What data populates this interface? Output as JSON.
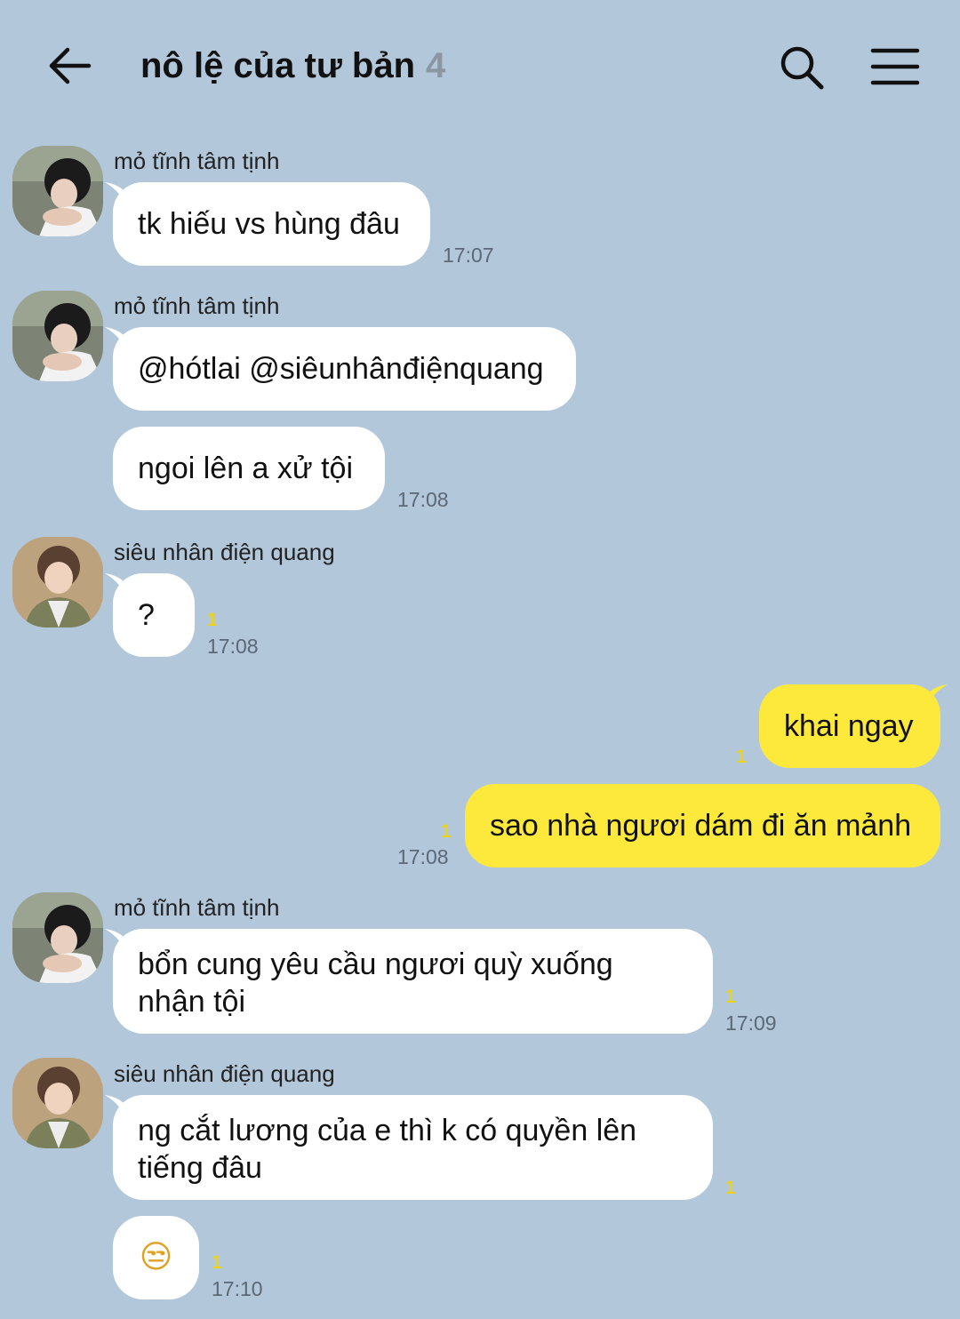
{
  "header": {
    "title": "nô lệ của tư bản",
    "member_count": "4",
    "back_icon": "arrow-left-icon",
    "search_icon": "search-icon",
    "menu_icon": "hamburger-menu-icon"
  },
  "colors": {
    "background": "#b3c7db",
    "incoming_bubble": "#ffffff",
    "outgoing_bubble": "#fce93c",
    "unread_count": "#e9d31a"
  },
  "messages": [
    {
      "sender": "mỏ tĩnh tâm tịnh",
      "text": "tk hiếu vs hùng đâu",
      "time": "17:07"
    },
    {
      "sender": "mỏ tĩnh tâm tịnh",
      "text": "@hótlai @siêunhânđiệnquang"
    },
    {
      "text": "ngoi lên a xử tội",
      "time": "17:08"
    },
    {
      "sender": "siêu nhân điện quang",
      "text": "?",
      "unread": "1",
      "time": "17:08"
    },
    {
      "text": "khai ngay",
      "unread": "1"
    },
    {
      "text": "sao nhà ngươi dám đi ăn mảnh",
      "unread": "1",
      "time": "17:08"
    },
    {
      "sender": "mỏ tĩnh tâm tịnh",
      "text": "bổn cung yêu cầu ngươi quỳ xuống nhận tội",
      "unread": "1",
      "time": "17:09"
    },
    {
      "sender": "siêu nhân điện quang",
      "text": "ng cắt lương của e thì k có quyền lên tiếng đâu",
      "unread": "1"
    },
    {
      "text": "😒",
      "unread": "1",
      "time": "17:10"
    }
  ]
}
